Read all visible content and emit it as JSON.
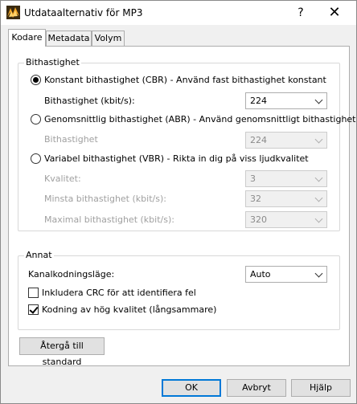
{
  "window": {
    "title": "Utdataalternativ för MP3",
    "help_glyph": "?",
    "close_glyph": "✕",
    "icon": "winamp-icon"
  },
  "tabs": [
    {
      "label": "Kodare",
      "active": true
    },
    {
      "label": "Metadata",
      "active": false
    },
    {
      "label": "Volym",
      "active": false
    }
  ],
  "bitrate_group": {
    "title": "Bithastighet",
    "cbr": {
      "label": "Konstant bithastighet (CBR) - Använd fast bithastighet konstant",
      "selected": true,
      "bitrate_label": "Bithastighet (kbit/s):",
      "bitrate_value": "224"
    },
    "abr": {
      "label": "Genomsnittlig bithastighet (ABR) - Använd genomsnittligt bithastighet",
      "selected": false,
      "bitrate_label": "Bithastighet",
      "bitrate_value": "224"
    },
    "vbr": {
      "label": "Variabel bithastighet (VBR) - Rikta in dig på viss ljudkvalitet",
      "selected": false,
      "quality_label": "Kvalitet:",
      "quality_value": "3",
      "min_label": "Minsta bithastighet (kbit/s):",
      "min_value": "32",
      "max_label": "Maximal bithastighet (kbit/s):",
      "max_value": "320"
    }
  },
  "other_group": {
    "title": "Annat",
    "channel_mode_label": "Kanalkodningsläge:",
    "channel_mode_value": "Auto",
    "crc_label": "Inkludera CRC för att identifiera fel",
    "crc_checked": false,
    "hq_label": "Kodning av hög kvalitet (långsammare)",
    "hq_checked": true
  },
  "buttons": {
    "reset": "Återgå till standard",
    "ok": "OK",
    "cancel": "Avbryt",
    "help": "Hjälp"
  }
}
